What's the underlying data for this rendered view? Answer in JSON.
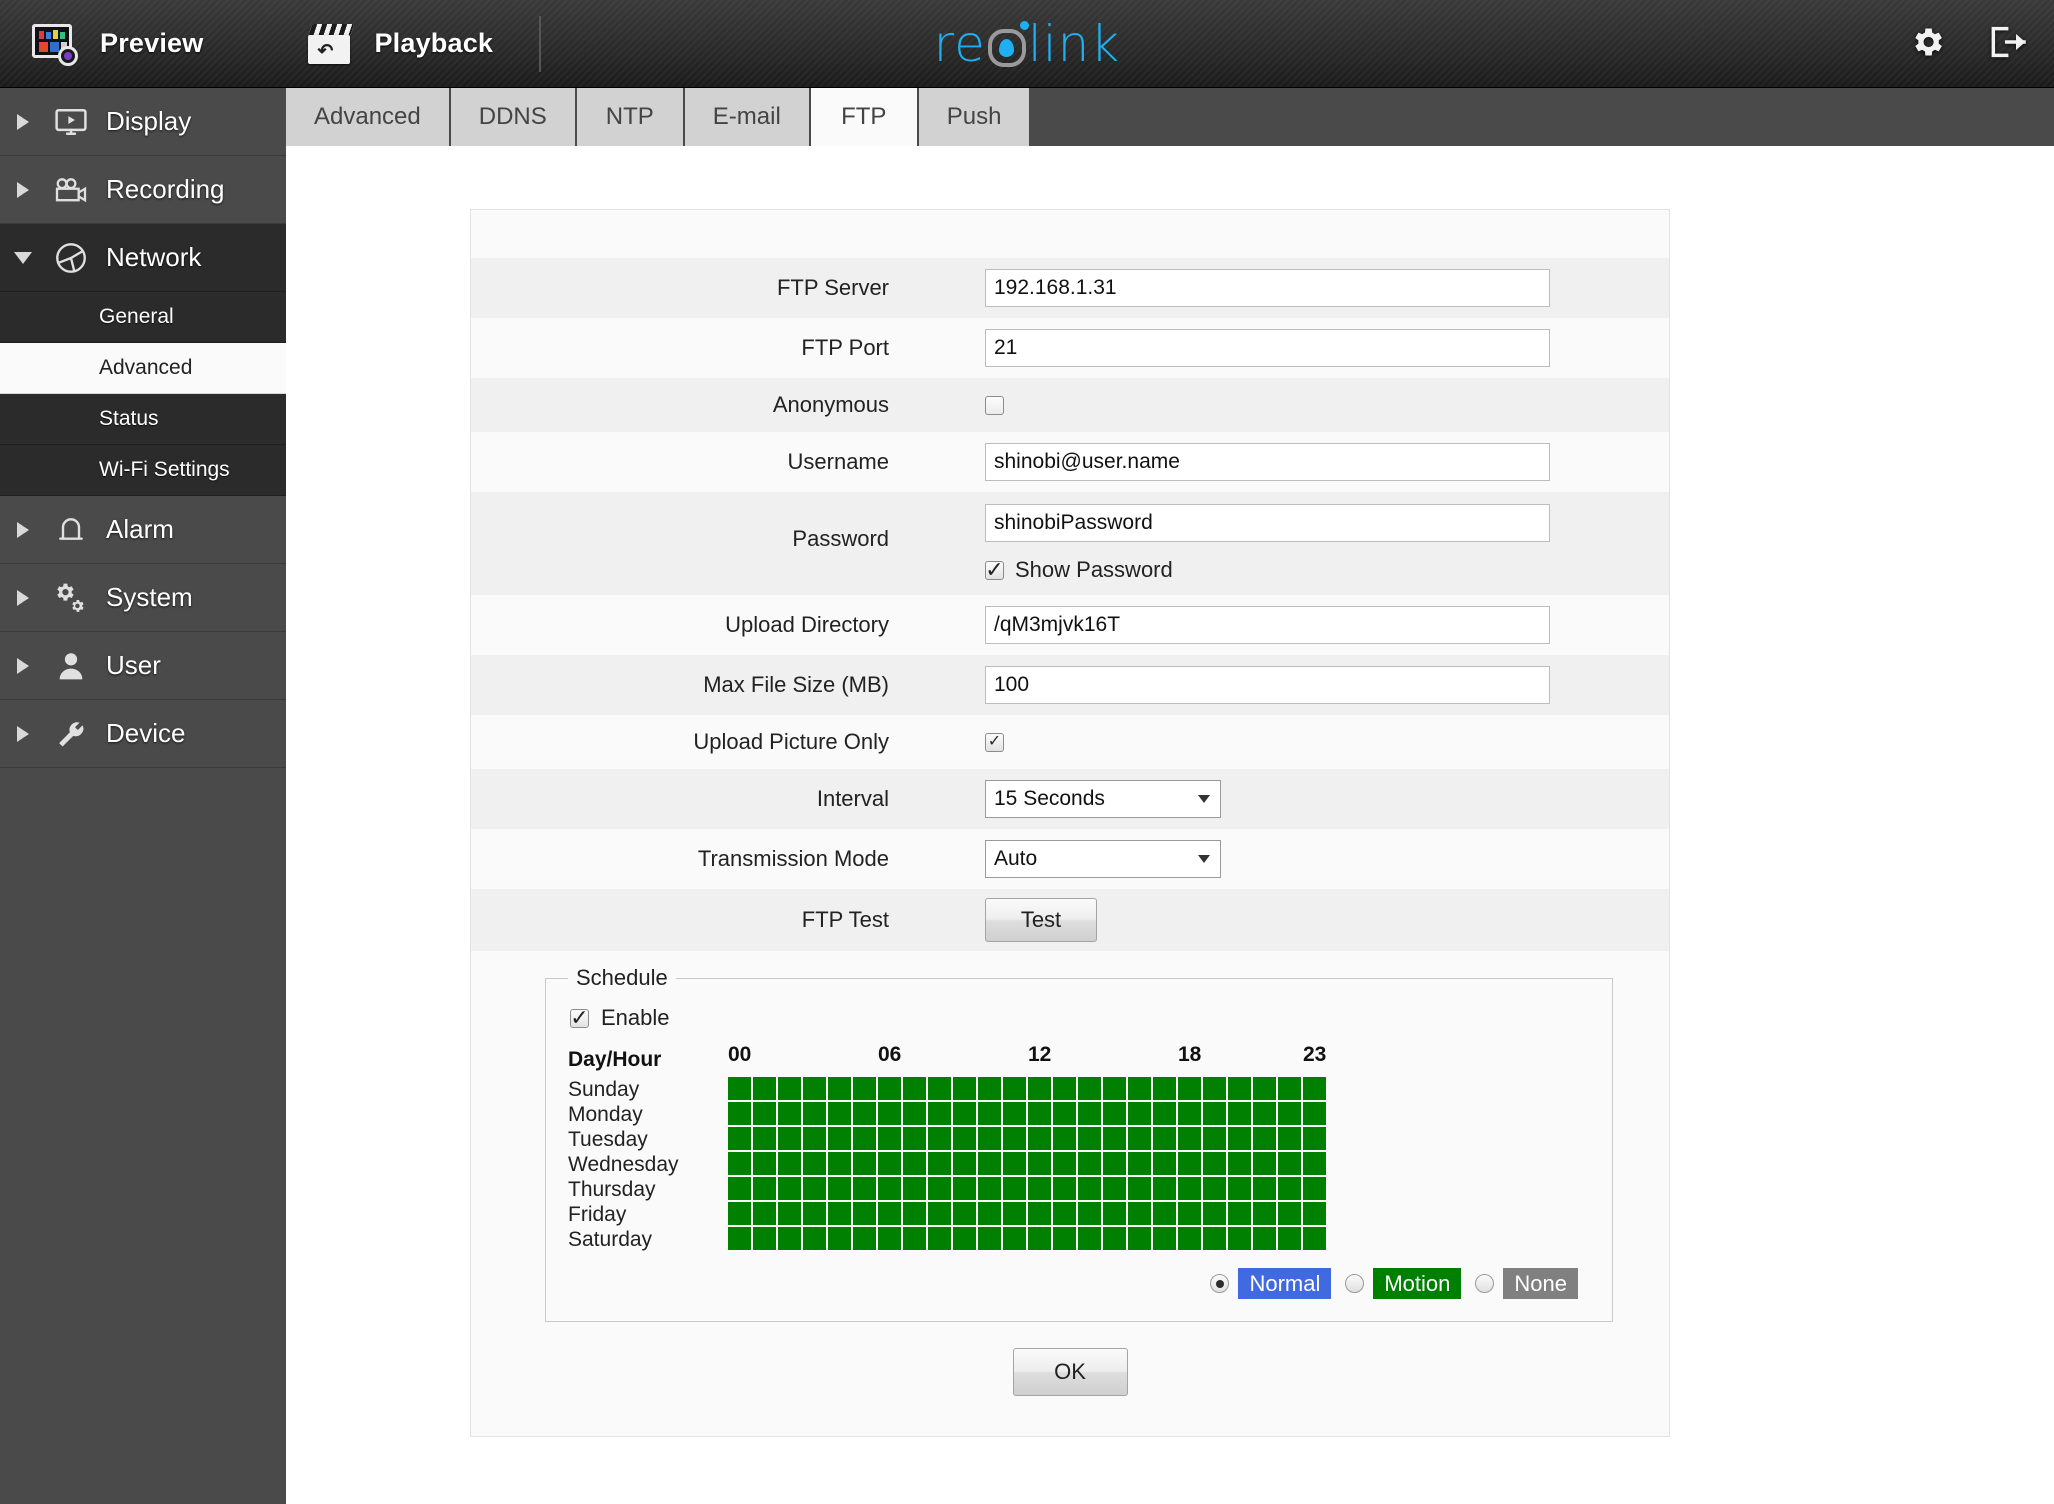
{
  "topbar": {
    "preview_label": "Preview",
    "playback_label": "Playback",
    "logo_part1": "re",
    "logo_part2": "link",
    "settings_icon": "gear-icon",
    "logout_icon": "logout-icon"
  },
  "sidebar": {
    "groups": [
      {
        "label": "Display",
        "icon": "monitor-icon",
        "expanded": false
      },
      {
        "label": "Recording",
        "icon": "video-camera-icon",
        "expanded": false
      },
      {
        "label": "Network",
        "icon": "network-globe-icon",
        "expanded": true
      },
      {
        "label": "Alarm",
        "icon": "bell-icon",
        "expanded": false
      },
      {
        "label": "System",
        "icon": "gears-icon",
        "expanded": false
      },
      {
        "label": "User",
        "icon": "person-icon",
        "expanded": false
      },
      {
        "label": "Device",
        "icon": "wrench-icon",
        "expanded": false
      }
    ],
    "network_subitems": [
      {
        "label": "General",
        "active": false
      },
      {
        "label": "Advanced",
        "active": true
      },
      {
        "label": "Status",
        "active": false
      },
      {
        "label": "Wi-Fi Settings",
        "active": false
      }
    ]
  },
  "tabs": [
    {
      "label": "Advanced",
      "active": false
    },
    {
      "label": "DDNS",
      "active": false
    },
    {
      "label": "NTP",
      "active": false
    },
    {
      "label": "E-mail",
      "active": false
    },
    {
      "label": "FTP",
      "active": true
    },
    {
      "label": "Push",
      "active": false
    }
  ],
  "form": {
    "ftp_server_label": "FTP Server",
    "ftp_server_value": "192.168.1.31",
    "ftp_port_label": "FTP Port",
    "ftp_port_value": "21",
    "anonymous_label": "Anonymous",
    "anonymous_checked": false,
    "username_label": "Username",
    "username_value": "shinobi@user.name",
    "password_label": "Password",
    "password_value": "shinobiPassword",
    "show_password_label": "Show Password",
    "show_password_checked": true,
    "upload_directory_label": "Upload Directory",
    "upload_directory_value": "/qM3mjvk16T",
    "max_file_size_label": "Max File Size (MB)",
    "max_file_size_value": "100",
    "upload_picture_only_label": "Upload Picture Only",
    "upload_picture_only_checked": true,
    "interval_label": "Interval",
    "interval_value": "15 Seconds",
    "transmission_mode_label": "Transmission Mode",
    "transmission_mode_value": "Auto",
    "ftp_test_label": "FTP Test",
    "test_button_label": "Test",
    "ok_button_label": "OK"
  },
  "schedule": {
    "legend_title": "Schedule",
    "enable_label": "Enable",
    "enable_checked": true,
    "dayhour_label": "Day/Hour",
    "hour_ticks": [
      "00",
      "06",
      "12",
      "18",
      "23"
    ],
    "days": [
      "Sunday",
      "Monday",
      "Tuesday",
      "Wednesday",
      "Thursday",
      "Friday",
      "Saturday"
    ],
    "cell_state": "Motion",
    "modes": [
      {
        "label": "Normal",
        "color": "#4169e1",
        "selected": true
      },
      {
        "label": "Motion",
        "color": "#008000",
        "selected": false
      },
      {
        "label": "None",
        "color": "#808080",
        "selected": false
      }
    ]
  },
  "colors": {
    "accent": "#1eb0f2",
    "motion_green": "#008000",
    "normal_blue": "#4169e1",
    "none_grey": "#808080"
  }
}
